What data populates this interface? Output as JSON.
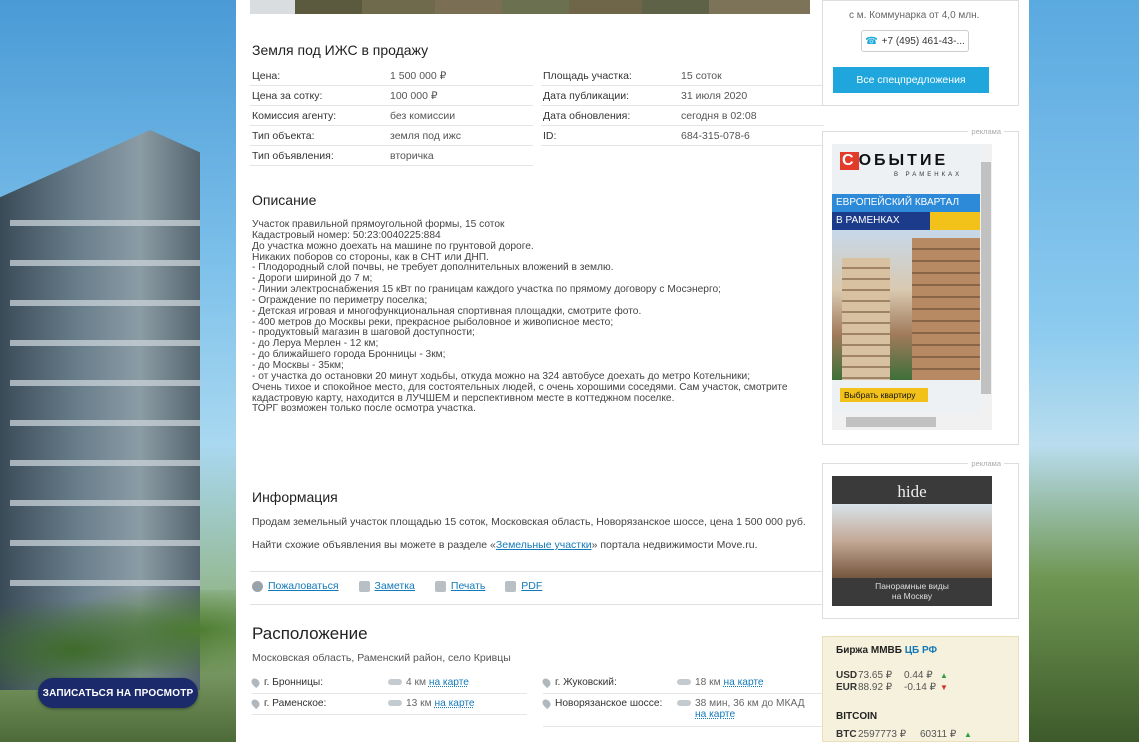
{
  "promo": {
    "cta": "ЗАПИСАТЬСЯ НА ПРОСМОТР"
  },
  "listing": {
    "title": "Земля под ИЖС в продажу",
    "props_left": [
      {
        "k": "Цена:",
        "v": "1 500 000 ₽"
      },
      {
        "k": "Цена за сотку:",
        "v": "100 000 ₽"
      },
      {
        "k": "Комиссия агенту:",
        "v": "без комиссии"
      },
      {
        "k": "Тип объекта:",
        "v": "земля под ижс"
      },
      {
        "k": "Тип объявления:",
        "v": "вторичка"
      }
    ],
    "props_right": [
      {
        "k": "Площадь участка:",
        "v": "15 соток"
      },
      {
        "k": "Дата публикации:",
        "v": "31 июля 2020"
      },
      {
        "k": "Дата обновления:",
        "v": "сегодня в 02:08"
      },
      {
        "k": "ID:",
        "v": "684-315-078-6"
      }
    ]
  },
  "description": {
    "title": "Описание",
    "text": "Участок правильной прямоугольной формы, 15 соток\nКадастровый номер: 50:23:0040225:884\nДо участка можно доехать на машине по грунтовой дороге.\nНикаких поборов со стороны, как в СНТ или ДНП.\n- Плодородный слой почвы, не требует дополнительных вложений в землю.\n- Дороги шириной до 7 м;\n- Линии электроснабжения 15 кВт по границам каждого участка по прямому договору с Мосэнерго;\n- Ограждение по периметру поселка;\n- Детская игровая и многофункциональная спортивная площадки, смотрите фото.\n- 400 метров до Москвы реки, прекрасное рыболовное и живописное место;\n- продуктовый магазин в шаговой доступности;\n- до Леруа Мерлен - 12 км;\n- до ближайшего города Бронницы - 3км;\n- до Москвы - 35км;\n- от участка до остановки 20 минут ходьбы, откуда можно на 324 автобусе доехать до метро Котельники;\nОчень тихое и спокойное место, для состоятельных людей, с очень хорошими соседями. Сам участок, смотрите\nкадастровую карту, находится в ЛУЧШЕМ и перспективном месте в коттеджном поселке.\nТОРГ возможен только после осмотра участка."
  },
  "info": {
    "title": "Информация",
    "line1": "Продам земельный участок площадью 15 соток, Московская область, Новорязанское шоссе, цена 1 500 000 руб.",
    "line2_pre": "Найти схожие объявления вы можете в разделе «",
    "line2_link": "Земельные участки",
    "line2_post": "» портала недвижимости Move.ru."
  },
  "actions": {
    "complain": "Пожаловаться",
    "note": "Заметка",
    "print": "Печать",
    "pdf": "PDF"
  },
  "location": {
    "title": "Расположение",
    "address": "Московская область, Раменский район, село Кривцы",
    "left": [
      {
        "name": "г. Бронницы:",
        "dist": "4 км",
        "map": "на карте"
      },
      {
        "name": "г. Раменское:",
        "dist": "13 км",
        "map": "на карте"
      }
    ],
    "right": [
      {
        "name": "г. Жуковский:",
        "dist": "18 км",
        "map": "на карте"
      },
      {
        "name": "Новорязанское шоссе:",
        "dist": "38 мин, 36 км до МКАД",
        "map": "на карте"
      }
    ]
  },
  "sidebar": {
    "metro": "с м. Коммунарка от 4,0 млн.",
    "phone": "+7 (495) 461-43-...",
    "special": "Все спецпредложения",
    "ad_label": "реклама",
    "ad1": {
      "logo_first": "С",
      "logo_rest": "ОБЫТИЕ",
      "sub": "В РАМЕНКАХ",
      "stripe1": "ЕВРОПЕЙСКИЙ КВАРТАЛ",
      "stripe2": "В РАМЕНКАХ",
      "button": "Выбрать квартиру"
    },
    "ad2": {
      "brand": "hide",
      "caption": "Панорамные виды\nна Москву"
    },
    "rates": {
      "title_pre": "Биржа ММВБ ",
      "title_link": "ЦБ РФ",
      "rows": [
        {
          "cur": "USD",
          "val": "73.65 ₽",
          "chg": "0.44 ₽",
          "dir": "▲"
        },
        {
          "cur": "EUR",
          "val": "88.92 ₽",
          "chg": "-0.14 ₽",
          "dir": "▼"
        }
      ],
      "btc_title": "BITCOIN",
      "btc": {
        "cur": "BTC",
        "val": "2597773 ₽",
        "chg": "60311 ₽",
        "dir": "▲"
      }
    }
  }
}
